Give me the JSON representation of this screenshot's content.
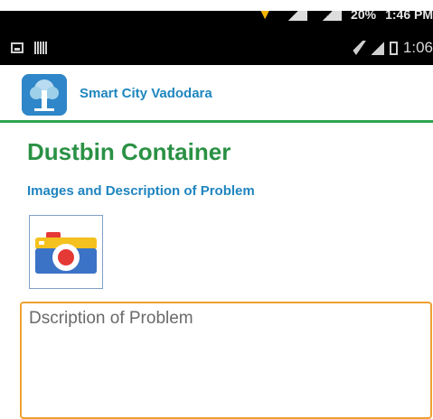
{
  "outer_status": {
    "battery_pct": "20%",
    "clock": "1:46 PM"
  },
  "status_bar": {
    "clock": "1:06"
  },
  "app": {
    "name": "Smart City Vadodara",
    "logo_icon": "tree-logo-icon"
  },
  "page": {
    "title": "Dustbin Container",
    "section_label": "Images and Description of Problem",
    "camera_icon": "camera-icon",
    "description": {
      "value": "",
      "placeholder": "Dscription of Problem"
    }
  },
  "colors": {
    "accent_green": "#2a9144",
    "accent_blue": "#1f84bf",
    "input_border": "#f0a030"
  }
}
